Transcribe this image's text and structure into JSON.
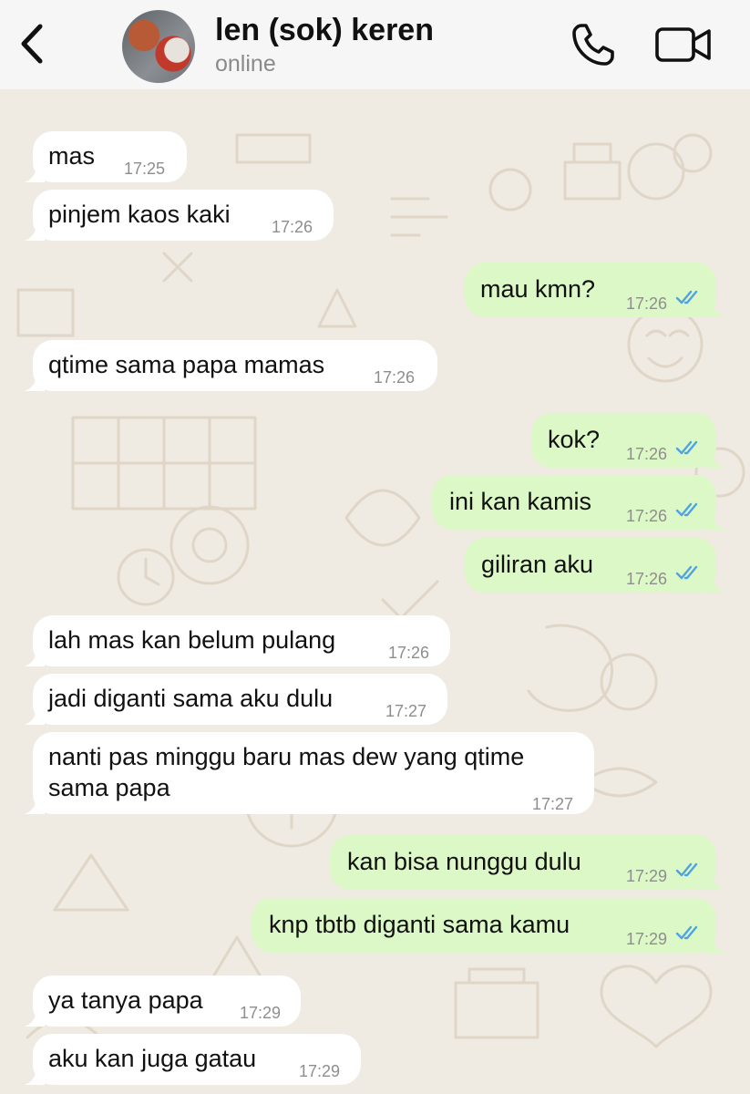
{
  "header": {
    "back_icon": "chevron-left-icon",
    "contact_name": "len (sok) keren",
    "status": "online",
    "call_icon": "phone-icon",
    "video_icon": "video-camera-icon",
    "accent_color": "#007aff"
  },
  "chat": {
    "incoming_bubble_color": "#ffffff",
    "outgoing_bubble_color": "#dcf8c6",
    "read_tick_color": "#4fa3e0",
    "messages": [
      {
        "direction": "in",
        "text": "mas",
        "time": "17:25"
      },
      {
        "direction": "in",
        "text": "pinjem kaos kaki",
        "time": "17:26"
      },
      {
        "direction": "out",
        "text": "mau kmn?",
        "time": "17:26",
        "status": "read"
      },
      {
        "direction": "in",
        "text": "qtime sama papa mamas",
        "time": "17:26"
      },
      {
        "direction": "out",
        "text": "kok?",
        "time": "17:26",
        "status": "read"
      },
      {
        "direction": "out",
        "text": "ini kan kamis",
        "time": "17:26",
        "status": "read"
      },
      {
        "direction": "out",
        "text": "giliran aku",
        "time": "17:26",
        "status": "read"
      },
      {
        "direction": "in",
        "text": "lah mas kan belum pulang",
        "time": "17:26"
      },
      {
        "direction": "in",
        "text": "jadi diganti sama aku dulu",
        "time": "17:27"
      },
      {
        "direction": "in",
        "text": "nanti pas minggu baru mas dew yang qtime\nsama papa",
        "time": "17:27"
      },
      {
        "direction": "out",
        "text": "kan bisa nunggu dulu",
        "time": "17:29",
        "status": "read"
      },
      {
        "direction": "out",
        "text": "knp tbtb diganti sama kamu",
        "time": "17:29",
        "status": "read"
      },
      {
        "direction": "in",
        "text": "ya tanya papa",
        "time": "17:29"
      },
      {
        "direction": "in",
        "text": "aku kan juga gatau",
        "time": "17:29"
      }
    ]
  }
}
